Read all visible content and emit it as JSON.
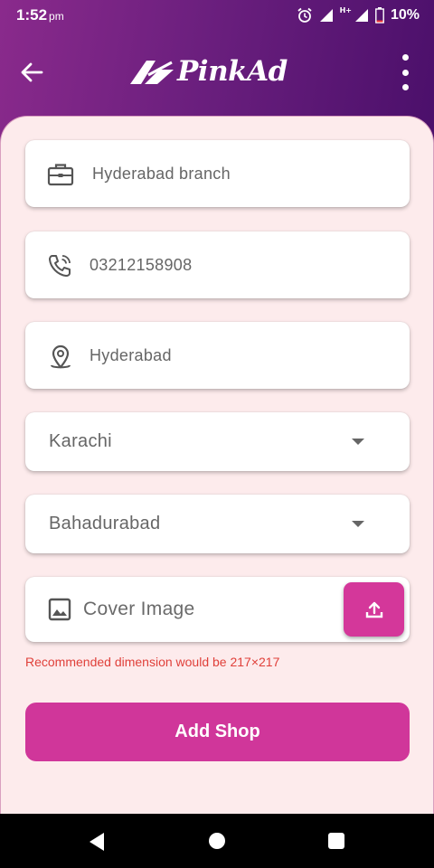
{
  "status_bar": {
    "time": "1:52",
    "ampm": "pm",
    "network": "H+",
    "battery": "10%"
  },
  "app_bar": {
    "brand": "PinkAd",
    "back_icon": "arrow-left-icon",
    "menu_icon": "more-vertical-icon"
  },
  "form": {
    "shop_name": {
      "value": "Hyderabad branch",
      "icon": "briefcase-icon"
    },
    "phone": {
      "value": "03212158908",
      "icon": "phone-icon"
    },
    "address": {
      "value": "Hyderabad",
      "icon": "location-pin-icon"
    },
    "city": {
      "selected": "Karachi"
    },
    "area": {
      "selected": "Bahadurabad"
    },
    "cover_image": {
      "label": "Cover Image",
      "icon": "image-icon",
      "upload_icon": "upload-icon"
    },
    "hint": "Recommended dimension would be 217×217",
    "submit_label": "Add Shop"
  },
  "colors": {
    "accent": "#d0369a",
    "header_gradient_start": "#8a2a8c",
    "header_gradient_end": "#4a0f6a",
    "sheet_bg": "#fdebec",
    "hint_text": "#e0403a"
  }
}
